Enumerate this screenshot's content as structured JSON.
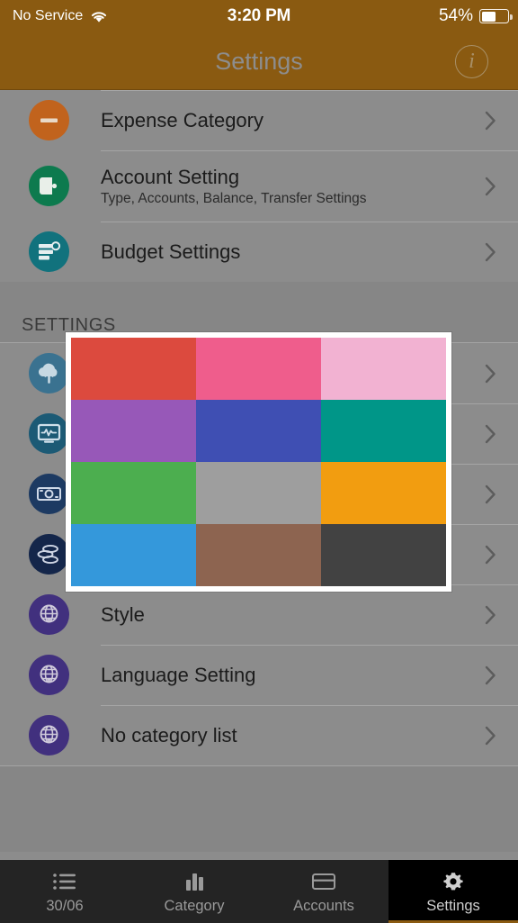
{
  "status_bar": {
    "carrier": "No Service",
    "wifi_icon": "wifi-icon",
    "time": "3:20 PM",
    "battery_percent": "54%",
    "battery_level": 54,
    "battery_icon": "battery-icon"
  },
  "nav_bar": {
    "title": "Settings",
    "info_icon": "info-icon",
    "info_glyph": "i",
    "background_color": "#8a5a11",
    "title_color": "#8d8d8d"
  },
  "list": {
    "top_rows": [
      {
        "icon": "minus-circle-icon",
        "icon_color": "#c1631d",
        "title": "Expense Category",
        "subtitle": "",
        "chevron": "chevron-right-icon"
      },
      {
        "icon": "wallet-icon",
        "icon_color": "#0d7a4e",
        "title": "Account Setting",
        "subtitle": "Type, Accounts, Balance, Transfer Settings",
        "chevron": "chevron-right-icon"
      },
      {
        "icon": "budget-bars-icon",
        "icon_color": "#11727d",
        "title": "Budget Settings",
        "subtitle": "",
        "chevron": "chevron-right-icon"
      }
    ],
    "section_header": "SETTINGS",
    "settings_rows": [
      {
        "icon": "cloud-upload-icon",
        "icon_color": "#3a7290",
        "title": "",
        "subtitle": "",
        "chevron": "chevron-right-icon"
      },
      {
        "icon": "monitor-chart-icon",
        "icon_color": "#1c5a75",
        "title": "",
        "subtitle": "",
        "chevron": "chevron-right-icon"
      },
      {
        "icon": "banknote-icon",
        "icon_color": "#1d3a62",
        "title": "",
        "subtitle": "",
        "chevron": "chevron-right-icon"
      },
      {
        "icon": "coins-icon",
        "icon_color": "#14264a",
        "title": "",
        "subtitle": "",
        "chevron": "chevron-right-icon"
      },
      {
        "icon": "globe-icon",
        "icon_color": "#41307e",
        "title": "Style",
        "subtitle": "",
        "chevron": "chevron-right-icon"
      },
      {
        "icon": "globe-icon",
        "icon_color": "#41307e",
        "title": "Language Setting",
        "subtitle": "",
        "chevron": "chevron-right-icon"
      },
      {
        "icon": "globe-icon",
        "icon_color": "#41307e",
        "title": "No category list",
        "subtitle": "",
        "chevron": "chevron-right-icon"
      }
    ]
  },
  "color_picker": {
    "border_color": "#ffffff",
    "swatches": [
      {
        "name": "red",
        "hex": "#dc4a3e"
      },
      {
        "name": "pink",
        "hex": "#ef5d8c"
      },
      {
        "name": "light-pink",
        "hex": "#f2b2d2"
      },
      {
        "name": "purple",
        "hex": "#9758b8"
      },
      {
        "name": "indigo",
        "hex": "#3f4fb3"
      },
      {
        "name": "teal",
        "hex": "#009688"
      },
      {
        "name": "green",
        "hex": "#4cae4f"
      },
      {
        "name": "grey",
        "hex": "#9e9e9e"
      },
      {
        "name": "orange",
        "hex": "#f29d10"
      },
      {
        "name": "blue",
        "hex": "#3498db"
      },
      {
        "name": "brown",
        "hex": "#8d6450"
      },
      {
        "name": "dark-grey",
        "hex": "#424242"
      }
    ]
  },
  "tab_bar": {
    "active_tab": "Settings",
    "accent_color": "#8a5a11",
    "tabs": [
      {
        "label": "30/06",
        "icon": "list-icon",
        "active": false
      },
      {
        "label": "Category",
        "icon": "bar-chart-icon",
        "active": false
      },
      {
        "label": "Accounts",
        "icon": "card-icon",
        "active": false
      },
      {
        "label": "Settings",
        "icon": "gear-icon",
        "active": true
      }
    ]
  }
}
